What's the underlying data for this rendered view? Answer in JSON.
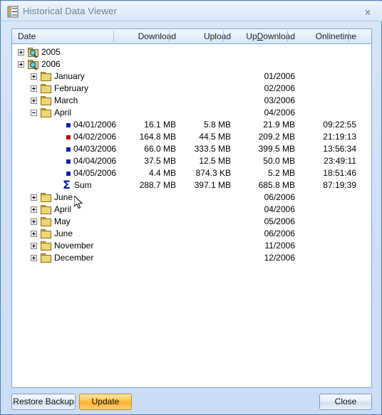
{
  "window": {
    "title": "Historical Data Viewer",
    "icon": "tree-list-icon",
    "close_label": "×"
  },
  "columns": [
    {
      "key": "date",
      "label": "Date"
    },
    {
      "key": "download",
      "label": "Download"
    },
    {
      "key": "upload",
      "label": "Upload"
    },
    {
      "key": "updownload",
      "label": "UpDownload",
      "accel": "D"
    },
    {
      "key": "onlinetime",
      "label": "Onlinetime"
    }
  ],
  "rows": [
    {
      "label": "2005",
      "icon": "search-folder-icon",
      "indent": 0,
      "expander": "plus",
      "download": "",
      "upload": "",
      "updownload": "",
      "onlinetime": ""
    },
    {
      "label": "2006",
      "icon": "search-folder-icon",
      "indent": 0,
      "expander": "plus",
      "download": "",
      "upload": "",
      "updownload": "",
      "onlinetime": ""
    },
    {
      "label": "January",
      "icon": "folder-icon",
      "indent": 1,
      "expander": "plus",
      "download": "",
      "upload": "",
      "updownload": "01/2006",
      "onlinetime": ""
    },
    {
      "label": "February",
      "icon": "folder-icon",
      "indent": 1,
      "expander": "plus",
      "download": "",
      "upload": "",
      "updownload": "02/2006",
      "onlinetime": ""
    },
    {
      "label": "March",
      "icon": "folder-icon",
      "indent": 1,
      "expander": "plus",
      "download": "",
      "upload": "",
      "updownload": "03/2006",
      "onlinetime": ""
    },
    {
      "label": "April",
      "icon": "folder-icon",
      "indent": 1,
      "expander": "minus",
      "download": "",
      "upload": "",
      "updownload": "04/2006",
      "onlinetime": ""
    },
    {
      "label": "04/01/2006",
      "icon": "bullet-blue",
      "indent": 2,
      "expander": "none",
      "download": "16.1 MB",
      "upload": "5.8 MB",
      "updownload": "21.9 MB",
      "onlinetime": "09:22:55"
    },
    {
      "label": "04/02/2006",
      "icon": "bullet-red",
      "indent": 2,
      "expander": "none",
      "download": "164.8 MB",
      "upload": "44.5 MB",
      "updownload": "209.2 MB",
      "onlinetime": "21:19:13"
    },
    {
      "label": "04/03/2006",
      "icon": "bullet-blue",
      "indent": 2,
      "expander": "none",
      "download": "66.0 MB",
      "upload": "333.5 MB",
      "updownload": "399.5 MB",
      "onlinetime": "13:56:34"
    },
    {
      "label": "04/04/2006",
      "icon": "bullet-blue",
      "indent": 2,
      "expander": "none",
      "download": "37.5 MB",
      "upload": "12.5 MB",
      "updownload": "50.0 MB",
      "onlinetime": "23:49:11"
    },
    {
      "label": "04/05/2006",
      "icon": "bullet-blue",
      "indent": 2,
      "expander": "none",
      "download": "4.4 MB",
      "upload": "874.3 KB",
      "updownload": "5.2 MB",
      "onlinetime": "18:51:46"
    },
    {
      "label": "Sum",
      "icon": "sigma-icon",
      "indent": 2,
      "expander": "none",
      "download": "288.7 MB",
      "upload": "397.1 MB",
      "updownload": "685.8 MB",
      "onlinetime": "87:19:39"
    },
    {
      "label": "June",
      "icon": "folder-icon",
      "indent": 1,
      "expander": "plus",
      "download": "",
      "upload": "",
      "updownload": "06/2006",
      "onlinetime": ""
    },
    {
      "label": "April",
      "icon": "folder-icon",
      "indent": 1,
      "expander": "plus",
      "download": "",
      "upload": "",
      "updownload": "04/2006",
      "onlinetime": ""
    },
    {
      "label": "May",
      "icon": "folder-icon",
      "indent": 1,
      "expander": "plus",
      "download": "",
      "upload": "",
      "updownload": "05/2006",
      "onlinetime": ""
    },
    {
      "label": "June",
      "icon": "folder-icon",
      "indent": 1,
      "expander": "plus",
      "download": "",
      "upload": "",
      "updownload": "06/2006",
      "onlinetime": ""
    },
    {
      "label": "November",
      "icon": "folder-icon",
      "indent": 1,
      "expander": "plus",
      "download": "",
      "upload": "",
      "updownload": "11/2006",
      "onlinetime": ""
    },
    {
      "label": "December",
      "icon": "folder-icon",
      "indent": 1,
      "expander": "plus",
      "download": "",
      "upload": "",
      "updownload": "12/2006",
      "onlinetime": ""
    }
  ],
  "buttons": {
    "restore_backup": "Restore Backup",
    "update": "Update",
    "close": "Close"
  },
  "colors": {
    "chrome": "#cfe0f6",
    "border": "#4c7bb0",
    "accent_update": "#ffb12e",
    "bullet_blue": "#0b1fa8",
    "bullet_red": "#c00000"
  }
}
